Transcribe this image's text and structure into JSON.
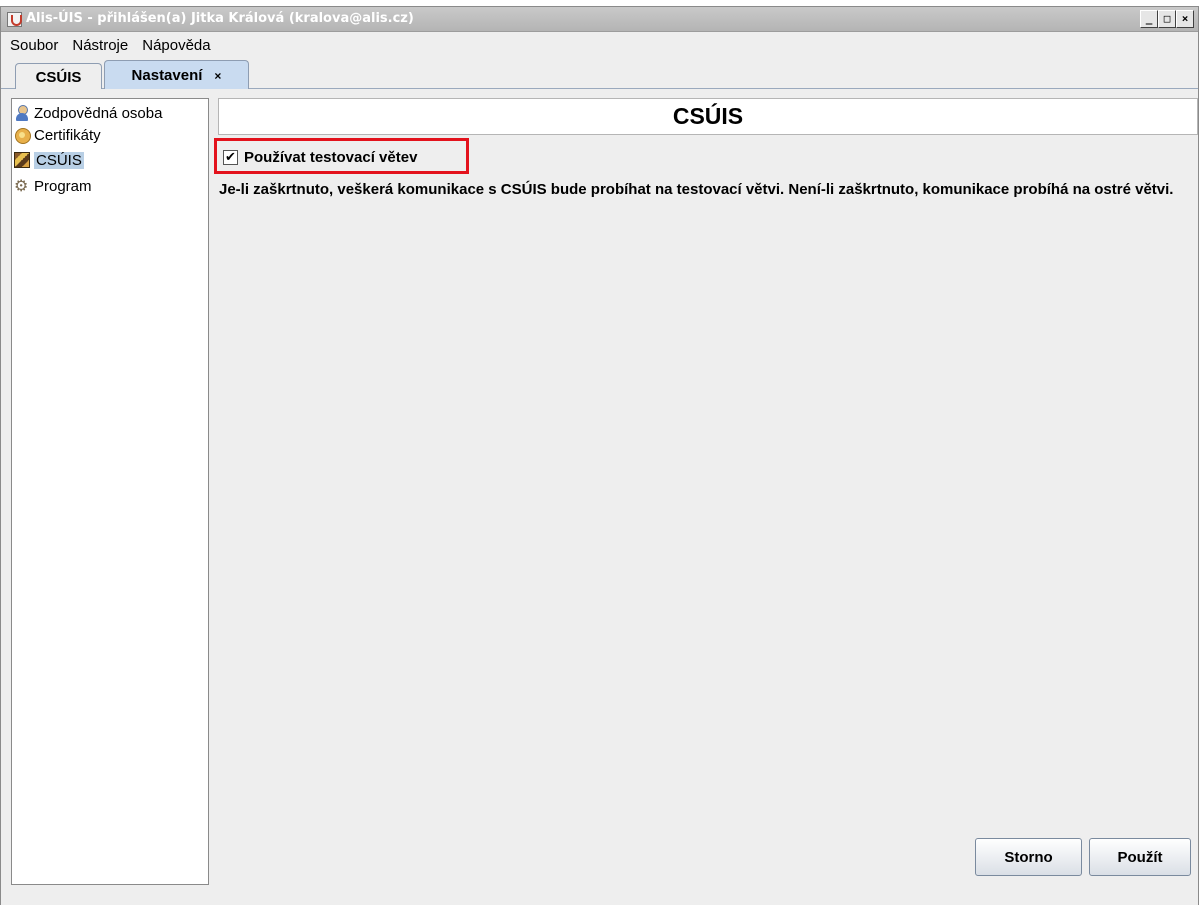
{
  "window": {
    "title": "Alis-ÚIS - přihlášen(a) Jitka Králová (kralova@alis.cz)",
    "controls": {
      "minimize": "_",
      "maximize": "□",
      "close": "×"
    }
  },
  "menubar": {
    "items": [
      "Soubor",
      "Nástroje",
      "Nápověda"
    ]
  },
  "tabs": [
    {
      "label": "CSÚIS",
      "active": false
    },
    {
      "label": "Nastavení",
      "active": true,
      "close": "×"
    }
  ],
  "tree": {
    "items": [
      {
        "label": "Zodpovědná osoba",
        "icon": "person-icon"
      },
      {
        "label": "Certifikáty",
        "icon": "certificate-icon"
      },
      {
        "label": "CSÚIS",
        "icon": "csuis-icon",
        "selected": true
      },
      {
        "label": "Program",
        "icon": "gear-icon"
      }
    ]
  },
  "panel": {
    "title": "CSÚIS",
    "checkbox": {
      "label": "Používat testovací větev",
      "checked": true,
      "mark": "✔"
    },
    "description": "Je-li zaškrtnuto, veškerá komunikace s CSÚIS bude probíhat na testovací větvi. Není-li zaškrtnuto, komunikace probíhá na ostré větvi.",
    "buttons": {
      "cancel": "Storno",
      "apply": "Použít"
    }
  },
  "colors": {
    "titlebar": "#b4b4b4",
    "active_tab": "#c9dbf0",
    "selection": "#b8cfe5",
    "highlight": "#e3121c"
  }
}
